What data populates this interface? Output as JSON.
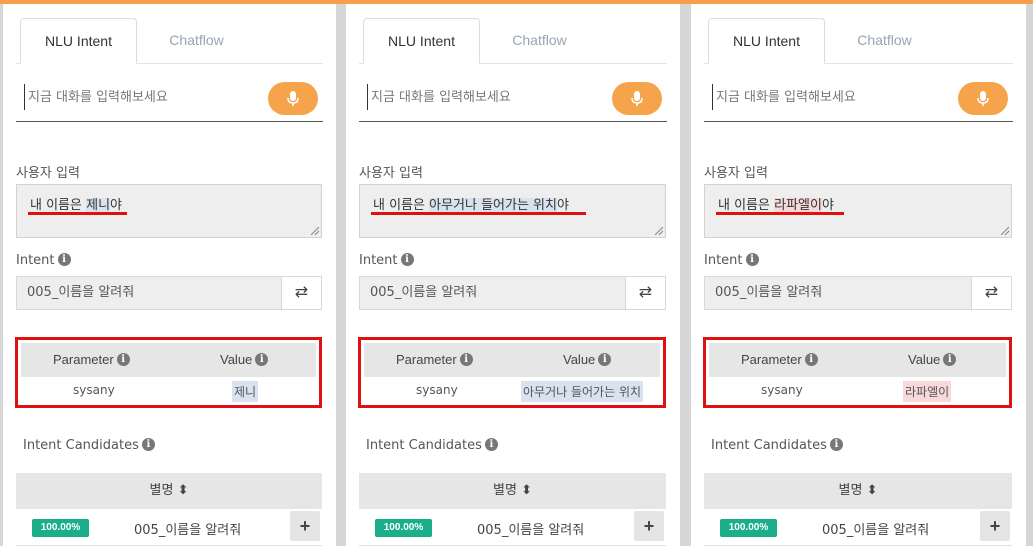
{
  "tabs": {
    "active": "NLU Intent",
    "inactive": "Chatflow"
  },
  "chat": {
    "placeholder": "지금 대화를 입력해보세요"
  },
  "labels": {
    "user_input": "사용자 입력",
    "intent": "Intent",
    "parameter": "Parameter",
    "value": "Value",
    "intent_candidates": "Intent Candidates",
    "alias": "별명 ⬍"
  },
  "icons": {
    "info": "info-icon",
    "mic": "mic-icon",
    "swap": "swap-icon",
    "plus": "plus-icon",
    "sort": "sort-icon"
  },
  "colors": {
    "accent": "#f5a44b",
    "badge": "#1aae8a",
    "highlight_box": "#e01010"
  },
  "panels": [
    {
      "user_text_prefix": "내 이름은 ",
      "user_text_value": "제니",
      "user_text_suffix": "야",
      "intent": "005_이름을 알려줘",
      "param_name": "sysany",
      "param_value": "제니",
      "candidate_score": "100.00%",
      "candidate_name": "005_이름을 알려줘"
    },
    {
      "user_text_prefix": "내 이름은 ",
      "user_text_value": "아무거나 들어가는 위치",
      "user_text_suffix": "야",
      "intent": "005_이름을 알려줘",
      "param_name": "sysany",
      "param_value": "아무거나 들어가는 위치",
      "candidate_score": "100.00%",
      "candidate_name": "005_이름을 알려줘"
    },
    {
      "user_text_prefix": "내 이름은 ",
      "user_text_value": "라파엘이",
      "user_text_suffix": "야",
      "intent": "005_이름을 알려줘",
      "param_name": "sysany",
      "param_value": "라파엘이",
      "candidate_score": "100.00%",
      "candidate_name": "005_이름을 알려줘"
    }
  ]
}
